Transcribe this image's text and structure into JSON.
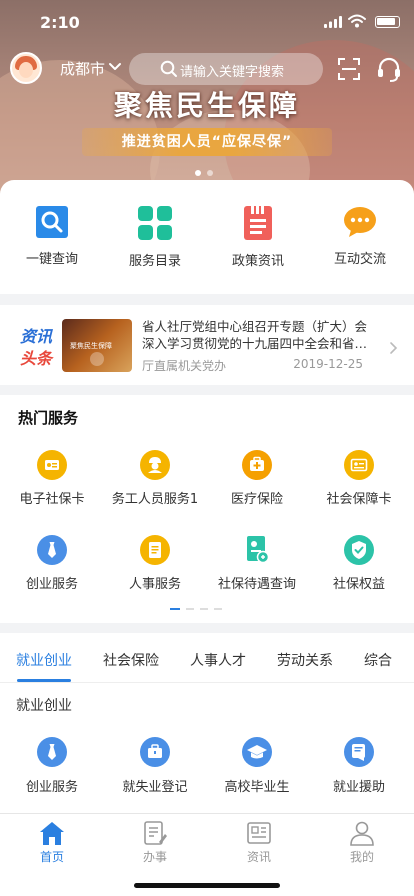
{
  "status_bar": {
    "time": "2:10"
  },
  "header": {
    "city": "成都市",
    "search_placeholder": "请输入关键字搜索"
  },
  "banner": {
    "headline": "聚焦民生保障",
    "subline": "推进贫困人员“应保尽保”",
    "page_count": 2,
    "active_page": 1
  },
  "quick_actions": [
    {
      "label": "一键查询",
      "icon": "search-icon"
    },
    {
      "label": "服务目录",
      "icon": "grid-icon"
    },
    {
      "label": "政策资讯",
      "icon": "document-icon"
    },
    {
      "label": "互动交流",
      "icon": "chat-icon"
    }
  ],
  "news": {
    "tag_line1": "资讯",
    "tag_line2": "头条",
    "thumb_text": "聚焦民生保障",
    "title": "省人社厅党组中心组召开专题（扩大）会深入学习贯彻党的十九届四中全会和省…",
    "source": "厅直属机关党办",
    "date": "2019-12-25"
  },
  "hot_services": {
    "heading": "热门服务",
    "items": [
      {
        "label": "电子社保卡",
        "icon": "id-card-icon",
        "color": "#f5b400"
      },
      {
        "label": "务工人员服务1",
        "icon": "worker-icon",
        "color": "#f5b400"
      },
      {
        "label": "医疗保险",
        "icon": "medical-kit-icon",
        "color": "#f5a000"
      },
      {
        "label": "社会保障卡",
        "icon": "social-card-icon",
        "color": "#f5b400"
      },
      {
        "label": "创业服务",
        "icon": "tie-icon",
        "color": "#4a8fe6"
      },
      {
        "label": "人事服务",
        "icon": "file-icon",
        "color": "#f5b400"
      },
      {
        "label": "社保待遇查询",
        "icon": "benefit-query-icon",
        "color": "#2cc3a8"
      },
      {
        "label": "社保权益",
        "icon": "shield-check-icon",
        "color": "#2cc3a8"
      }
    ],
    "pager_count": 4,
    "pager_active": 0
  },
  "categories": {
    "tabs": [
      "就业创业",
      "社会保险",
      "人事人才",
      "劳动关系",
      "综合"
    ],
    "active_tab": 0,
    "section_title": "就业创业",
    "items": [
      {
        "label": "创业服务",
        "icon": "tie-icon"
      },
      {
        "label": "就失业登记",
        "icon": "briefcase-icon"
      },
      {
        "label": "高校毕业生",
        "icon": "graduation-cap-icon"
      },
      {
        "label": "就业援助",
        "icon": "assist-icon"
      }
    ]
  },
  "tab_bar": [
    {
      "label": "首页",
      "icon": "home-icon",
      "active": true
    },
    {
      "label": "办事",
      "icon": "edit-doc-icon",
      "active": false
    },
    {
      "label": "资讯",
      "icon": "newspaper-icon",
      "active": false
    },
    {
      "label": "我的",
      "icon": "user-icon",
      "active": false
    }
  ],
  "colors": {
    "accent": "#2a7fe0",
    "yellow": "#f5b400",
    "teal": "#2cc3a8",
    "red_tag": "#e8483b"
  }
}
